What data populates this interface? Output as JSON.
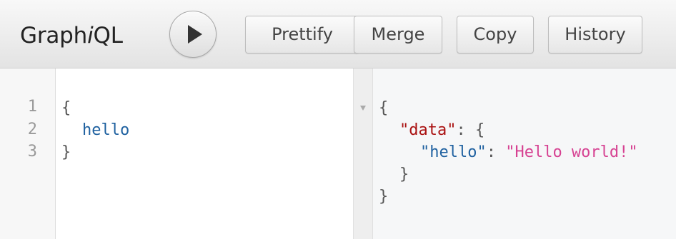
{
  "header": {
    "title_pre": "Graph",
    "title_italic": "i",
    "title_post": "QL",
    "run_button_icon": "play-icon",
    "buttons": {
      "prettify": "Prettify",
      "merge": "Merge",
      "copy": "Copy",
      "history": "History"
    }
  },
  "query_editor": {
    "line_numbers": [
      "1",
      "2",
      "3"
    ],
    "lines": {
      "open_brace": "{",
      "field": "hello",
      "close_brace": "}"
    }
  },
  "result": {
    "open_brace": "{",
    "data_key": "\"data\"",
    "data_sep": ": {",
    "hello_key": "\"hello\"",
    "hello_sep": ": ",
    "hello_value": "\"Hello world!\"",
    "inner_close": "}",
    "outer_close": "}"
  },
  "colors": {
    "field": "#1f61a0",
    "json_key_outer": "#aa1111",
    "json_string": "#d64292"
  }
}
